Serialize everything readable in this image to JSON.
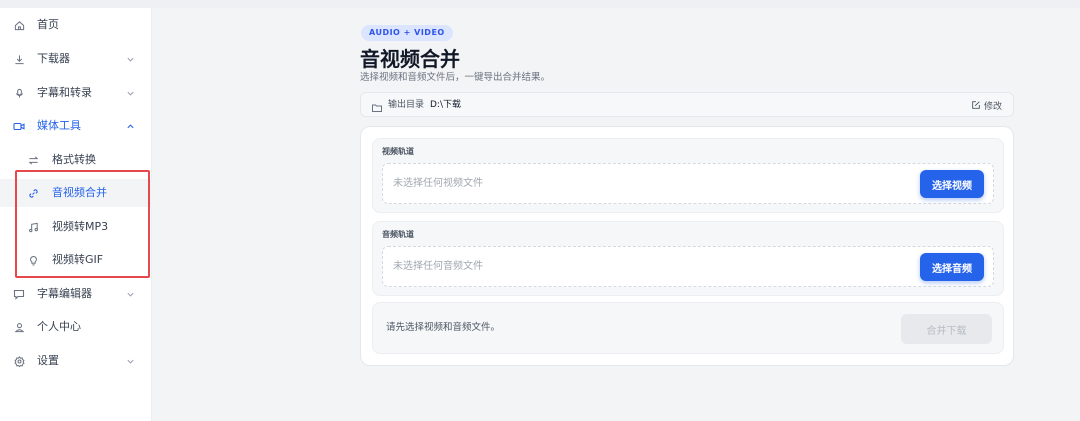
{
  "sidebar": {
    "items": [
      {
        "label": "首页"
      },
      {
        "label": "下载器"
      },
      {
        "label": "字幕和转录"
      },
      {
        "label": "媒体工具"
      },
      {
        "label": "格式转换"
      },
      {
        "label": "音视频合并"
      },
      {
        "label": "视频转MP3"
      },
      {
        "label": "视频转GIF"
      },
      {
        "label": "字幕编辑器"
      },
      {
        "label": "个人中心"
      },
      {
        "label": "设置"
      }
    ]
  },
  "header": {
    "tag": "AUDIO + VIDEO",
    "title": "音视频合并",
    "subtitle": "选择视频和音频文件后，一键导出合并结果。"
  },
  "output": {
    "label": "输出目录",
    "path": "D:\\下载",
    "edit_label": "修改"
  },
  "video_track": {
    "label": "视频轨道",
    "placeholder": "未选择任何视频文件",
    "button": "选择视频"
  },
  "audio_track": {
    "label": "音频轨道",
    "placeholder": "未选择任何音频文件",
    "button": "选择音频"
  },
  "footer": {
    "status": "请先选择视频和音频文件。",
    "merge_button": "合并下载"
  },
  "colors": {
    "accent": "#2563eb",
    "highlight_box": "#e5484d",
    "tag_bg": "#dbe5ff"
  }
}
